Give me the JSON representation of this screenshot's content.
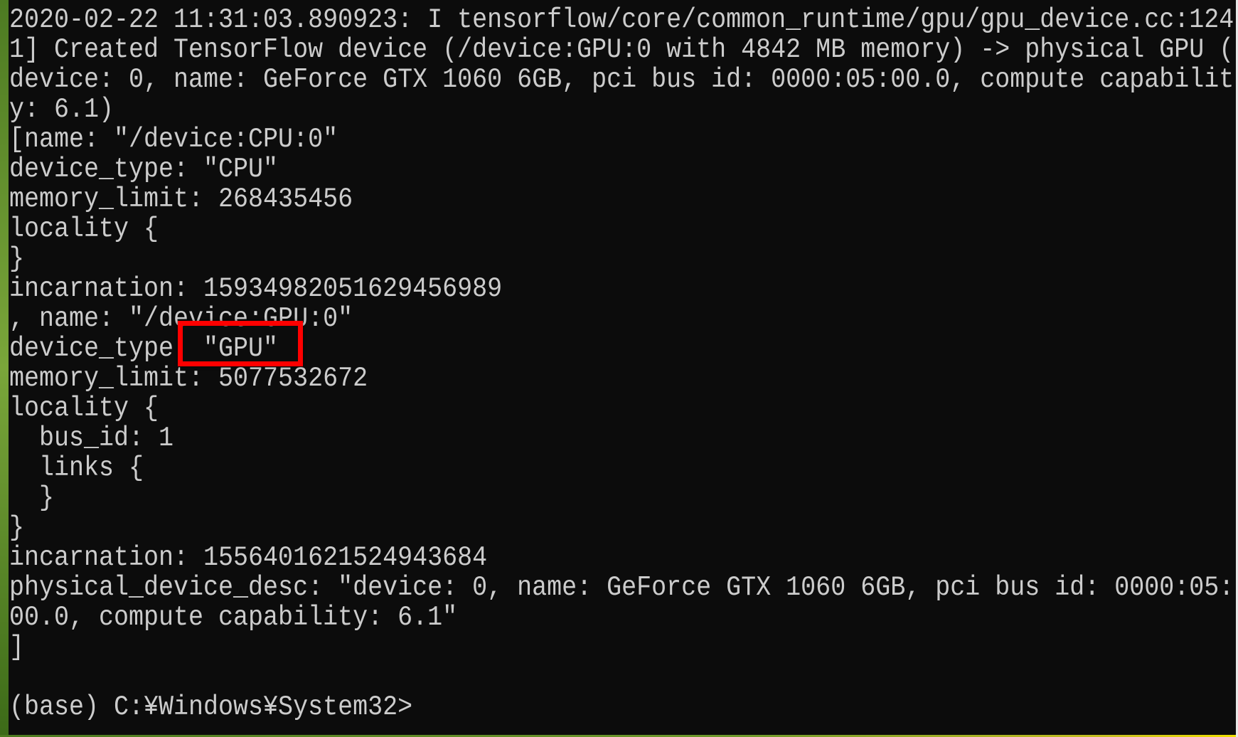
{
  "terminal": {
    "lines": [
      "2020-02-22 11:31:03.890923: I tensorflow/core/common_runtime/gpu/gpu_device.cc:124",
      "1] Created TensorFlow device (/device:GPU:0 with 4842 MB memory) -> physical GPU (",
      "device: 0, name: GeForce GTX 1060 6GB, pci bus id: 0000:05:00.0, compute capabilit",
      "y: 6.1)",
      "[name: \"/device:CPU:0\"",
      "device_type: \"CPU\"",
      "memory_limit: 268435456",
      "locality {",
      "}",
      "incarnation: 15934982051629456989",
      ", name: \"/device:GPU:0\"",
      "device_type: \"GPU\"",
      "memory_limit: 5077532672",
      "locality {",
      "  bus_id: 1",
      "  links {",
      "  }",
      "}",
      "incarnation: 1556401621524943684",
      "physical_device_desc: \"device: 0, name: GeForce GTX 1060 6GB, pci bus id: 0000:05:",
      "00.0, compute capability: 6.1\"",
      "]",
      "",
      "(base) C:¥Windows¥System32>"
    ],
    "highlight_color": "#ff0000",
    "background_color": "#0c0c0c",
    "text_color": "#cccccc"
  }
}
